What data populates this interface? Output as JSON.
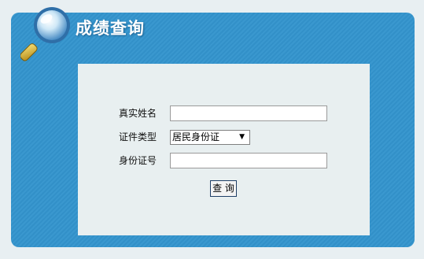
{
  "header": {
    "title": "成绩查询"
  },
  "form": {
    "name_label": "真实姓名",
    "name_value": "",
    "id_type_label": "证件类型",
    "id_type_selected": "居民身份证",
    "id_number_label": "身份证号",
    "id_number_value": "",
    "submit_label": "查 询"
  },
  "icons": {
    "header_icon": "magnifier-icon",
    "dropdown_icon": "caret-down-icon"
  },
  "colors": {
    "panel": "#3a98cf",
    "inner": "#e8eff0",
    "page": "#e8eff2"
  }
}
